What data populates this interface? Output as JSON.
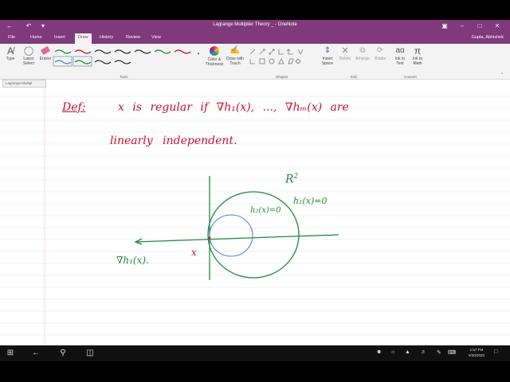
{
  "window": {
    "title": "Lagrange Multiplier Theory _ - OneNote",
    "user": "Gupta, Abhishek"
  },
  "menu": [
    {
      "label": "File"
    },
    {
      "label": "Home"
    },
    {
      "label": "Insert"
    },
    {
      "label": "Draw"
    },
    {
      "label": "History"
    },
    {
      "label": "Review"
    },
    {
      "label": "View"
    }
  ],
  "ribbon": {
    "type_label": "Type",
    "lasso_label": "Lasso Select",
    "eraser_label": "Eraser",
    "color_label": "Color & Thickness",
    "touch_label": "Draw with Touch",
    "insert_space_label": "Insert Space",
    "delete_label": "Delete",
    "arrange_label": "Arrange",
    "rotate_label": "Rotate",
    "ink_text_label": "Ink to Text",
    "ink_math_label": "Ink to Math",
    "group_tools": "Tools",
    "group_shapes": "Shapes",
    "group_edit": "Edit",
    "group_convert": "Convert"
  },
  "page_tab": "Lagrange Multipl",
  "notes": {
    "def_label": "Def:",
    "def_text": "x is regular if ∇h₁(x), ..., ∇hₘ(x) are",
    "line2": "linearly independent.",
    "r2": "R",
    "r2_exp": "2",
    "h2": "h₂(x)=0",
    "h1": "h₁(x)=0",
    "x_point": "x",
    "grad": "∇h₁(x)."
  },
  "taskbar": {
    "time": "1:57 PM",
    "date": "9/30/2020"
  },
  "colors": {
    "accent": "#80397b",
    "ink_red": "#c8102e",
    "ink_green": "#1e8a3a",
    "ink_blue": "#5b7fd6"
  }
}
